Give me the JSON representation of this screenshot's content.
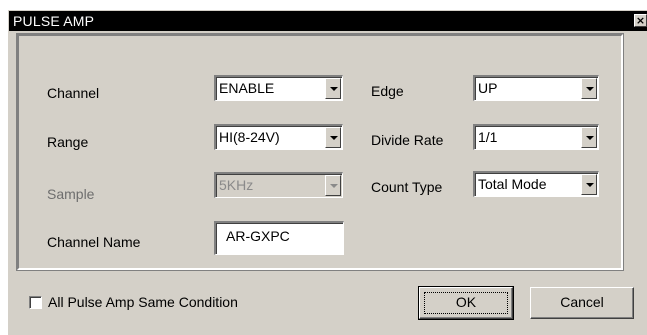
{
  "window": {
    "title": "PULSE AMP",
    "close_glyph": "×"
  },
  "fields": {
    "channel": {
      "label": "Channel",
      "value": "ENABLE"
    },
    "range": {
      "label": "Range",
      "value": "HI(8-24V)"
    },
    "sample": {
      "label": "Sample",
      "value": "5KHz"
    },
    "channel_name": {
      "label": "Channel Name",
      "value": "AR-GXPC"
    },
    "edge": {
      "label": "Edge",
      "value": "UP"
    },
    "divide_rate": {
      "label": "Divide Rate",
      "value": "1/1"
    },
    "count_type": {
      "label": "Count Type",
      "value": "Total Mode"
    }
  },
  "footer": {
    "same_condition_label": "All Pulse Amp Same Condition",
    "ok_label": "OK",
    "cancel_label": "Cancel"
  }
}
